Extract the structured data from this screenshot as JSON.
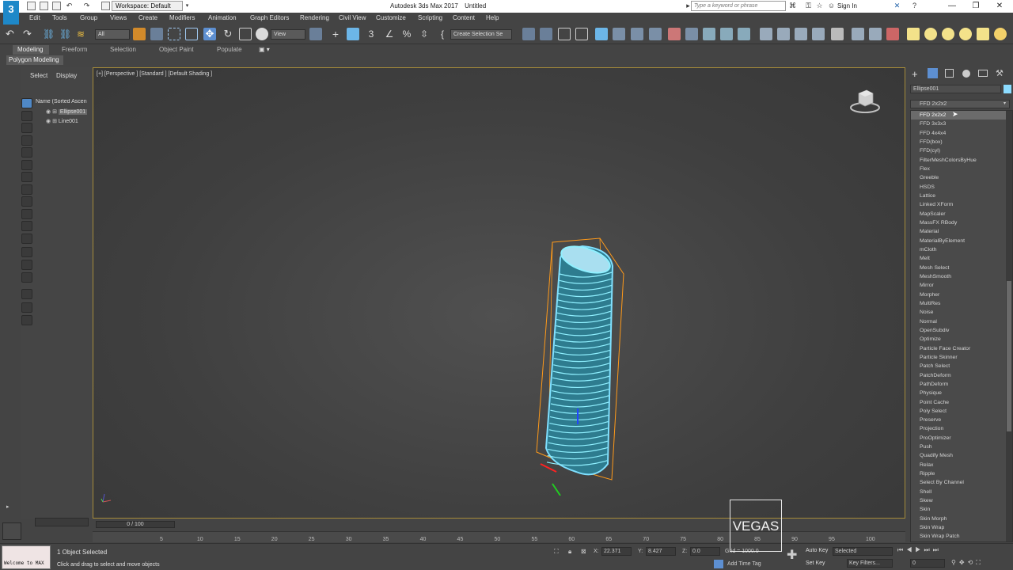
{
  "window": {
    "app_title": "Autodesk 3ds Max 2017",
    "document_title": "Untitled",
    "workspace": "Workspace: Default",
    "search_placeholder": "Type a keyword or phrase",
    "sign_in": "Sign In",
    "logo": "3"
  },
  "menu": [
    "Edit",
    "Tools",
    "Group",
    "Views",
    "Create",
    "Modifiers",
    "Animation",
    "Graph Editors",
    "Rendering",
    "Civil View",
    "Customize",
    "Scripting",
    "Content",
    "Help"
  ],
  "toolbar": {
    "selection_filter": "All",
    "ref_coord": "View",
    "named_selection": "Create Selection Se"
  },
  "ribbon": {
    "tabs": [
      "Modeling",
      "Freeform",
      "Selection",
      "Object Paint",
      "Populate"
    ],
    "active_tab": "Modeling",
    "sub_label": "Polygon Modeling"
  },
  "explorer": {
    "tab_select": "Select",
    "tab_display": "Display",
    "column_header": "Name (Sorted Ascen",
    "items": [
      "Ellipse001",
      "Line001"
    ]
  },
  "viewport": {
    "label": "[+] [Perspective ] [Standard ] [Default Shading ]"
  },
  "command_panel": {
    "object_name": "Ellipse001",
    "object_color": "#8cdcff",
    "modifier_dropdown": "FFD 2x2x2",
    "selected_modifier": "FFD 2x2x2",
    "modifiers": [
      "FFD 2x2x2",
      "FFD 3x3x3",
      "FFD 4x4x4",
      "FFD(box)",
      "FFD(cyl)",
      "FilterMeshColorsByHue",
      "Flex",
      "Greeble",
      "HSDS",
      "Lattice",
      "Linked XForm",
      "MapScaler",
      "MassFX RBody",
      "Material",
      "MaterialByElement",
      "mCloth",
      "Melt",
      "Mesh Select",
      "MeshSmooth",
      "Mirror",
      "Morpher",
      "MultiRes",
      "Noise",
      "Normal",
      "OpenSubdiv",
      "Optimize",
      "Particle Face Creator",
      "Particle Skinner",
      "Patch Select",
      "PatchDeform",
      "PathDeform",
      "Physique",
      "Point Cache",
      "Poly Select",
      "Preserve",
      "Projection",
      "ProOptimizer",
      "Push",
      "Quadify Mesh",
      "Relax",
      "Ripple",
      "Select By Channel",
      "Shell",
      "Skew",
      "Skin",
      "Skin Morph",
      "Skin Wrap",
      "Skin Wrap Patch"
    ]
  },
  "timeline": {
    "slider": "0 / 100",
    "ticks": [
      "5",
      "10",
      "15",
      "20",
      "25",
      "30",
      "35",
      "40",
      "45",
      "50",
      "55",
      "60",
      "65",
      "70",
      "75",
      "80",
      "85",
      "90",
      "95",
      "100"
    ]
  },
  "status": {
    "maxscript_text": "Welcome to MAX",
    "selection_status": "1 Object Selected",
    "prompt": "Click and drag to select and move objects",
    "x_label": "X:",
    "x_value": "22.371",
    "y_label": "Y:",
    "y_value": "8.427",
    "z_label": "Z:",
    "z_value": "0.0",
    "grid": "Grid = 1000.0",
    "add_time_tag": "Add Time Tag",
    "auto_key": "Auto Key",
    "set_key": "Set Key",
    "selected_dropdown": "Selected",
    "key_filters": "Key Filters...",
    "frame": "0"
  },
  "watermark": "VEGAS"
}
